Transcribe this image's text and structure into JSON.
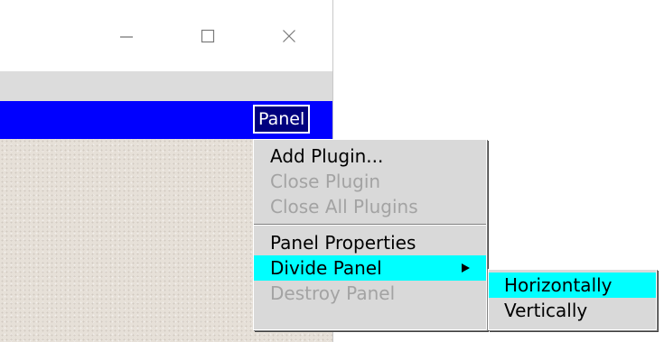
{
  "window": {
    "controls": {
      "minimize_icon": "minimize-icon",
      "maximize_icon": "maximize-icon",
      "close_icon": "close-icon"
    }
  },
  "panel_bar": {
    "color": "#0000ff",
    "menu_label": "Panel"
  },
  "panel_menu": {
    "items": [
      {
        "label": "Add Plugin...",
        "enabled": true
      },
      {
        "label": "Close Plugin",
        "enabled": false
      },
      {
        "label": "Close All Plugins",
        "enabled": false
      },
      {
        "label": "Panel Properties",
        "enabled": true
      },
      {
        "label": "Divide Panel",
        "enabled": true,
        "has_submenu": true,
        "highlighted": true
      },
      {
        "label": "Destroy Panel",
        "enabled": false
      }
    ],
    "highlight_color": "#00ffff"
  },
  "divide_submenu": {
    "items": [
      {
        "label": "Horizontally",
        "highlighted": true
      },
      {
        "label": "Vertically",
        "highlighted": false
      }
    ]
  }
}
